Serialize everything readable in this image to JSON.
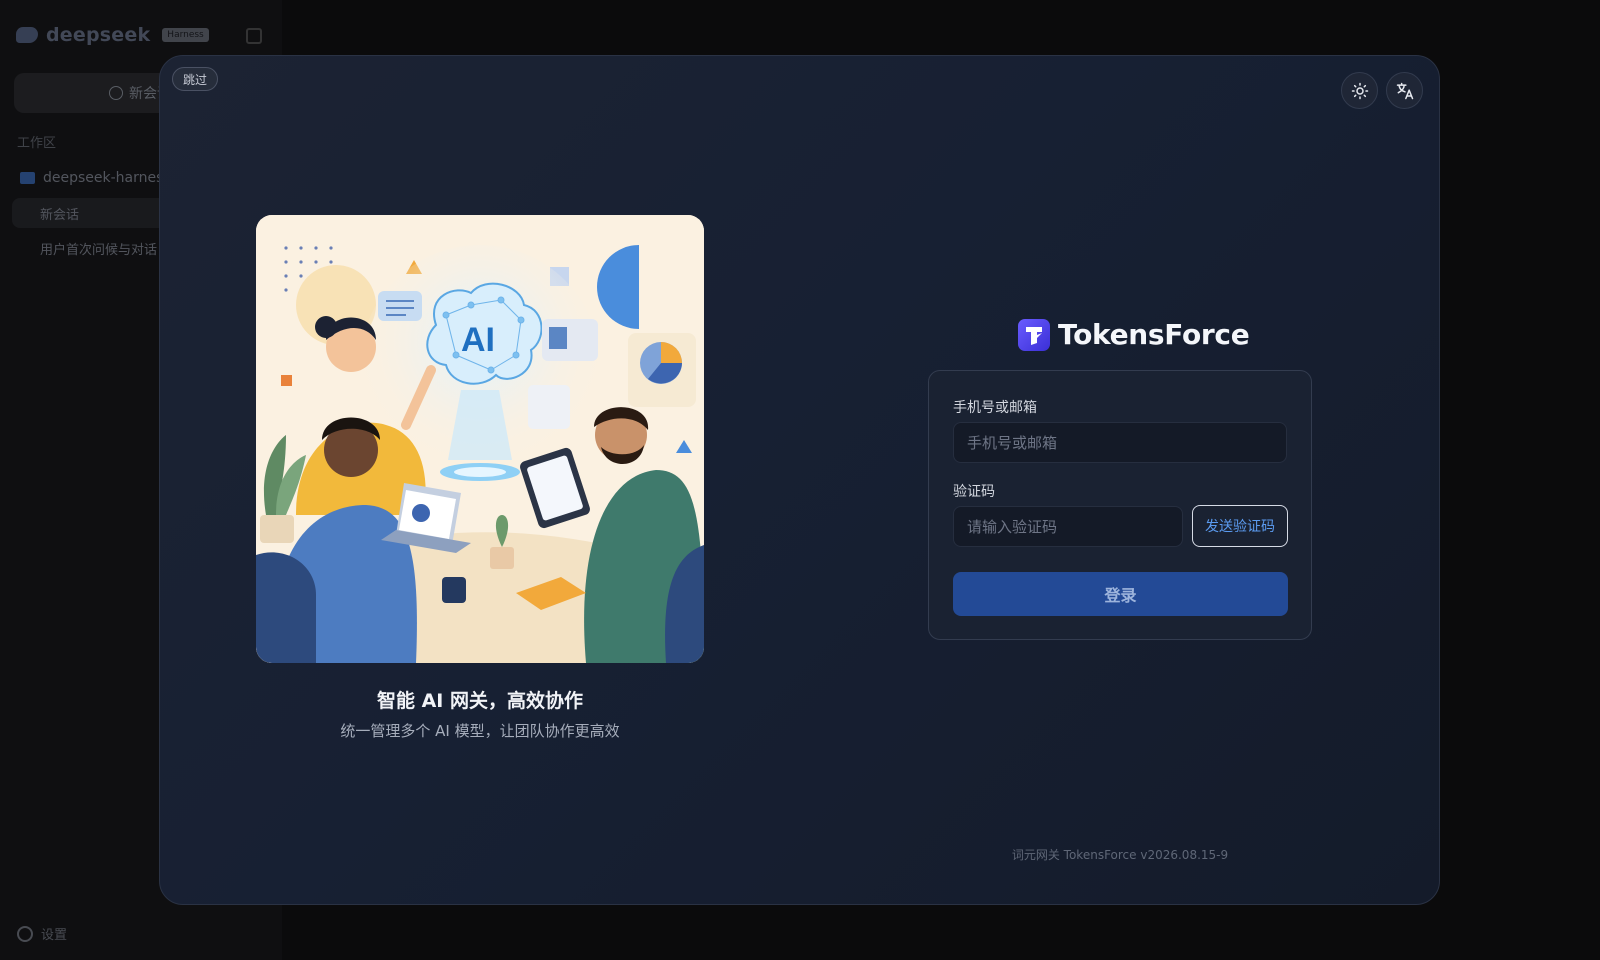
{
  "background_app": {
    "logo_text": "deepseek",
    "logo_badge": "Harness",
    "new_chat_label": "新会话",
    "section_label": "工作区",
    "folder_name": "deepseek-harness",
    "items": [
      "新会话",
      "用户首次问候与对话"
    ],
    "settings_label": "设置"
  },
  "modal": {
    "skip_label": "跳过",
    "theme_icon": "sun-icon",
    "language_icon": "translate-icon",
    "illustration": {
      "center_text": "AI",
      "title": "智能 AI 网关，高效协作",
      "subtitle": "统一管理多个 AI 模型，让团队协作更高效"
    },
    "brand": {
      "name": "TokensForce"
    },
    "login": {
      "phone_label": "手机号或邮箱",
      "phone_placeholder": "手机号或邮箱",
      "code_label": "验证码",
      "code_placeholder": "请输入验证码",
      "send_code_label": "发送验证码",
      "submit_label": "登录"
    },
    "footer": "词元网关 TokensForce v2026.08.15-9"
  },
  "colors": {
    "accent": "#234a96",
    "link": "#5b9bf0",
    "brand": "#4f46e5"
  }
}
